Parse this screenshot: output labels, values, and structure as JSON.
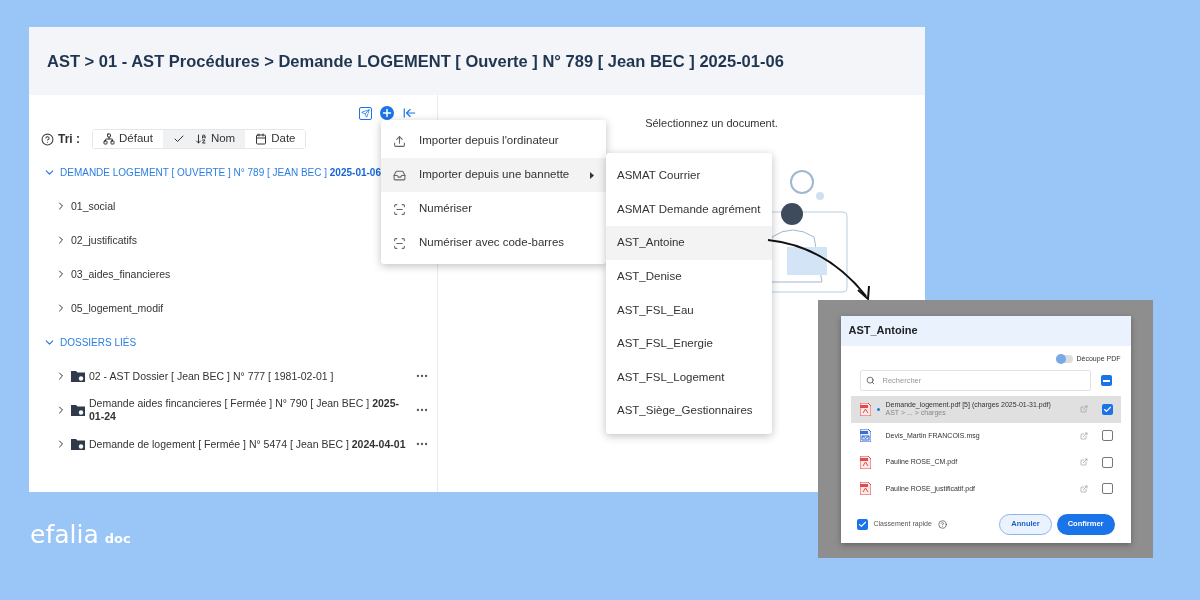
{
  "window": {
    "title": "AST > 01 - AST Procédures > Demande LOGEMENT [ Ouverte ] N° 789 [ Jean BEC ] **2025-01-06**"
  },
  "sort": {
    "label": "Tri :",
    "options": [
      {
        "label": "Défaut",
        "kind": "default",
        "selected": false
      },
      {
        "label": "Nom",
        "kind": "name",
        "selected": true
      },
      {
        "label": "Date",
        "kind": "date",
        "selected": false
      }
    ]
  },
  "tree": [
    {
      "label": "DEMANDE LOGEMENT [ OUVERTE ] N° 789 [ JEAN BEC ] **2025-01-06**",
      "expanded": true,
      "children": [
        {
          "label": "01_social",
          "kind": "folder",
          "expanded": false
        },
        {
          "label": "02_justificatifs",
          "kind": "folder",
          "expanded": false
        },
        {
          "label": "03_aides_financieres",
          "kind": "folder",
          "expanded": false
        },
        {
          "label": "05_logement_modif",
          "kind": "folder",
          "expanded": false
        }
      ]
    },
    {
      "label": "DOSSIERS LIÉS",
      "expanded": true,
      "children": [
        {
          "label": "02 - AST Dossier [ Jean BEC ] N° 777 [ 1981-02-01 ]",
          "kind": "linked",
          "expanded": false
        },
        {
          "label": "Demande aides fincancieres [ Fermée ] N° 790 [ Jean BEC ] **2025-01-24**",
          "kind": "linked",
          "expanded": false
        },
        {
          "label": "Demande de logement [ Fermée ] N° 5474 [ Jean BEC ] **2024-04-01**",
          "kind": "linked",
          "expanded": false
        }
      ]
    }
  ],
  "menu": {
    "items": [
      {
        "label": "Importer depuis l'ordinateur",
        "kind": "upload",
        "selected": false,
        "submenu": false
      },
      {
        "label": "Importer depuis une bannette",
        "kind": "inbox",
        "selected": true,
        "submenu": true
      },
      {
        "label": "Numériser",
        "kind": "scan",
        "selected": false,
        "submenu": false
      },
      {
        "label": "Numériser avec code-barres",
        "kind": "scan",
        "selected": false,
        "submenu": false
      }
    ]
  },
  "submenu": {
    "items": [
      {
        "label": "ASMAT Courrier",
        "selected": false
      },
      {
        "label": "ASMAT Demande agrément",
        "selected": false
      },
      {
        "label": "AST_Antoine",
        "selected": true
      },
      {
        "label": "AST_Denise",
        "selected": false
      },
      {
        "label": "AST_FSL_Eau",
        "selected": false
      },
      {
        "label": "AST_FSL_Energie",
        "selected": false
      },
      {
        "label": "AST_FSL_Logement",
        "selected": false
      },
      {
        "label": "AST_Siège_Gestionnaires",
        "selected": false
      }
    ]
  },
  "preview": {
    "message": "Sélectionnez un document."
  },
  "dialog": {
    "title": "AST_Antoine",
    "toggle": {
      "label": "Découpe PDF",
      "on": false
    },
    "search": {
      "placeholder": "Rechercher"
    },
    "select_all": {
      "checked": true,
      "indeterminate": true
    },
    "files": [
      {
        "name": "Demande_logement.pdf [5] (charges 2025-01-31.pdf)",
        "path": "AST > ... > charges",
        "kind": "pdf",
        "unread": true,
        "selected": true,
        "checked": true
      },
      {
        "name": "Devis_Martin FRANCOIS.msg",
        "kind": "msg",
        "unread": false,
        "selected": false,
        "checked": false
      },
      {
        "name": "Pauline ROSE_CM.pdf",
        "kind": "pdf",
        "unread": false,
        "selected": false,
        "checked": false
      },
      {
        "name": "Pauline ROSE_justificatif.pdf",
        "kind": "pdf",
        "unread": false,
        "selected": false,
        "checked": false
      }
    ],
    "quick": {
      "label": "Classement rapide",
      "checked": true
    },
    "buttons": [
      {
        "label": "Annuler",
        "kind": "secondary"
      },
      {
        "label": "Confirmer",
        "kind": "primary"
      }
    ]
  },
  "brand": {
    "name": "efalia",
    "product": "doc"
  }
}
